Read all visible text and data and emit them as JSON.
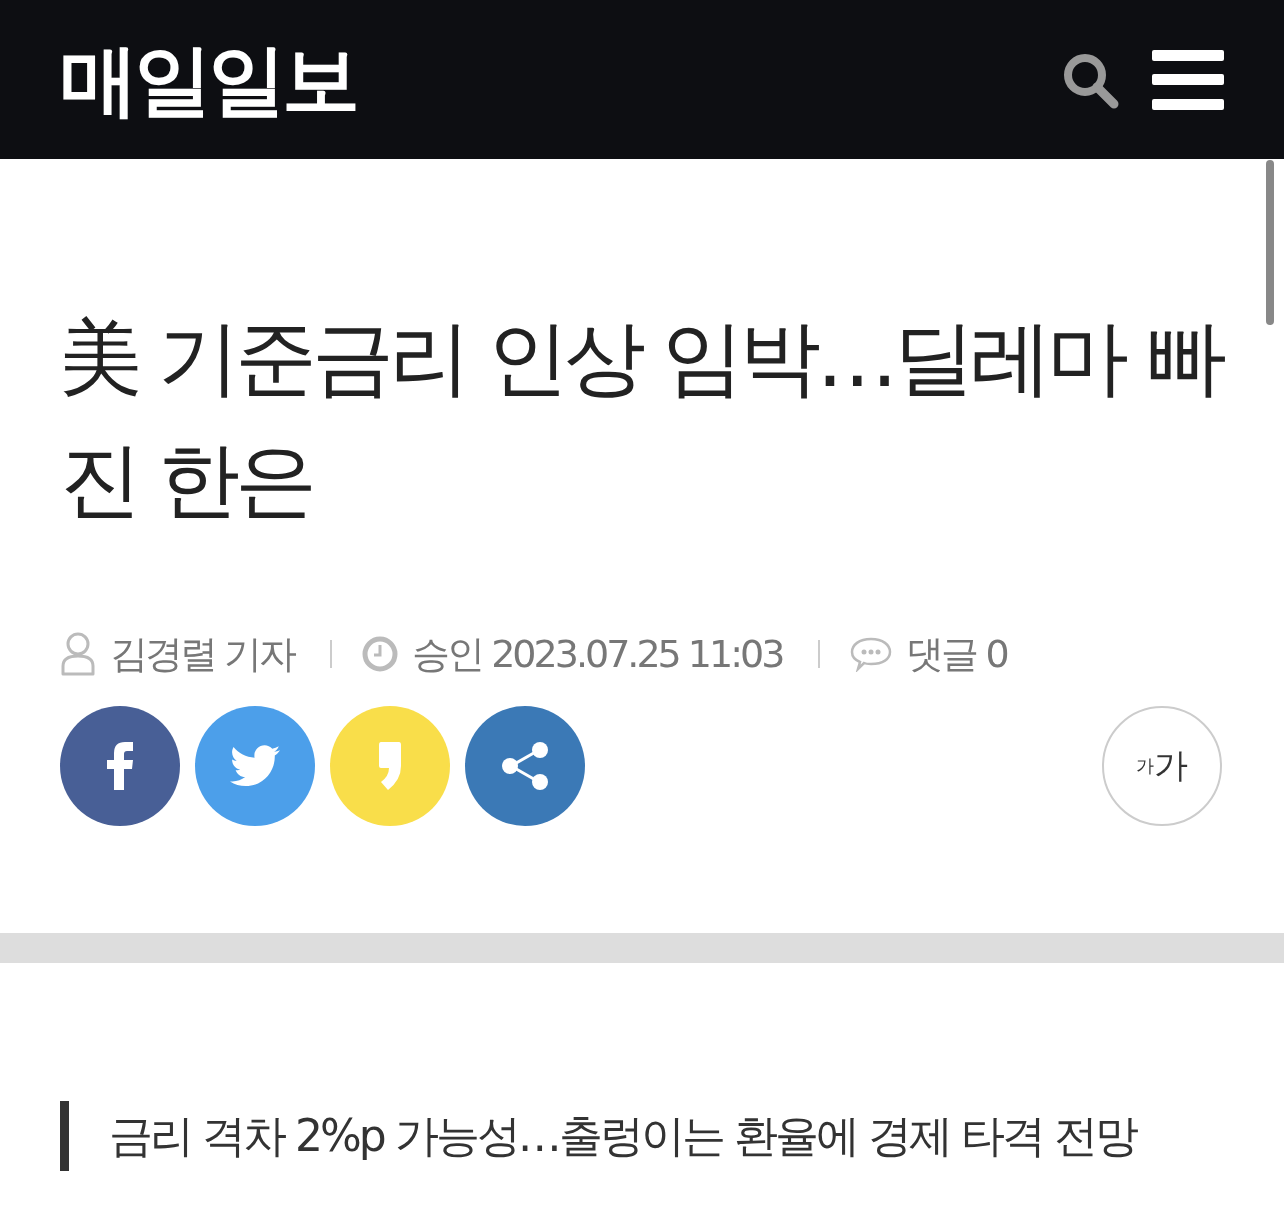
{
  "header": {
    "logo": "매일일보"
  },
  "article": {
    "title": "美 기준금리 인상 임박…딜레마 빠진 한은",
    "meta": [
      {
        "kind": "author",
        "text": "김경렬 기자"
      },
      {
        "kind": "time",
        "text": "승인 2023.07.25 11:03"
      },
      {
        "kind": "comments",
        "text": "댓글 0"
      }
    ],
    "share_buttons": [
      {
        "kind": "facebook"
      },
      {
        "kind": "twitter"
      },
      {
        "kind": "kakaostory"
      },
      {
        "kind": "share"
      }
    ],
    "font_size_button": {
      "small": "가",
      "large": "가"
    },
    "subtitle": "금리 격차 2%p 가능성…출렁이는 환율에 경제 타격 전망"
  }
}
